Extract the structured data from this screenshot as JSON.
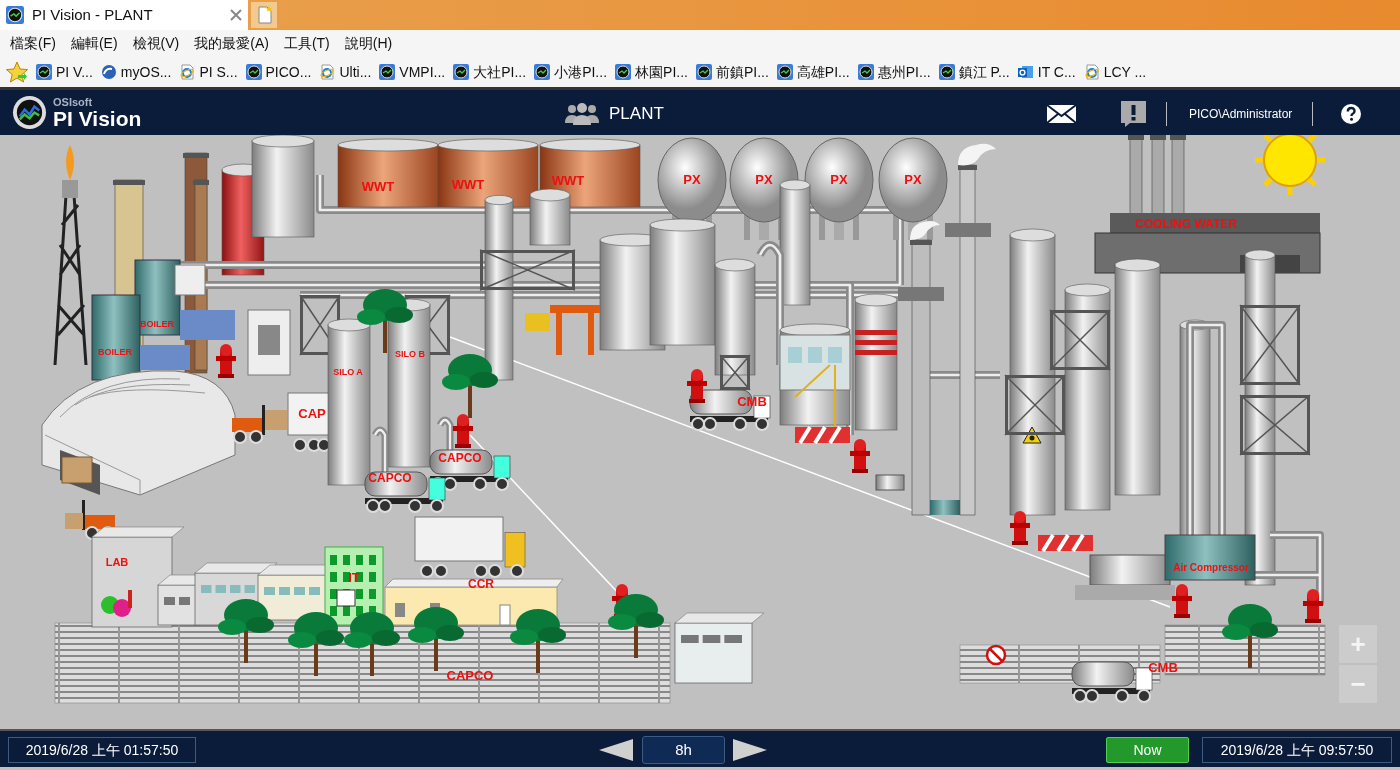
{
  "browser": {
    "tabs": [
      {
        "title": "PI Vision - PLANT",
        "selected": true
      }
    ],
    "menu": [
      "檔案(F)",
      "編輯(E)",
      "檢視(V)",
      "我的最愛(A)",
      "工具(T)",
      "說明(H)"
    ],
    "favorites": [
      {
        "label": "PI V...",
        "kind": "pi"
      },
      {
        "label": "myOS...",
        "kind": "swirl"
      },
      {
        "label": "PI S...",
        "kind": "page"
      },
      {
        "label": "PICO...",
        "kind": "pi"
      },
      {
        "label": "Ulti...",
        "kind": "page"
      },
      {
        "label": "VMPI...",
        "kind": "pi"
      },
      {
        "label": "大社PI...",
        "kind": "pi"
      },
      {
        "label": "小港PI...",
        "kind": "pi"
      },
      {
        "label": "林園PI...",
        "kind": "pi"
      },
      {
        "label": "前鎮PI...",
        "kind": "pi"
      },
      {
        "label": "高雄PI...",
        "kind": "pi"
      },
      {
        "label": "惠州PI...",
        "kind": "pi"
      },
      {
        "label": "鎮江 P...",
        "kind": "pi"
      },
      {
        "label": "IT C...",
        "kind": "tile"
      },
      {
        "label": "LCY ...",
        "kind": "page"
      }
    ]
  },
  "app": {
    "vendor": "OSIsoft",
    "product": "PI Vision",
    "display": "PLANT",
    "user": "PICO\\Administrator"
  },
  "plant": {
    "labels": [
      "WWT",
      "WWT",
      "WWT",
      "PX",
      "PX",
      "PX",
      "PX",
      "COOLING WATER",
      "BOILER",
      "BOILER",
      "SILO A",
      "SILO B",
      "CAP",
      "CAPCO",
      "CAPCO",
      "CAPCO",
      "CMB",
      "CMB",
      "LAB",
      "IT",
      "CCR",
      "Air Compressor"
    ],
    "zoom": [
      "+",
      "−"
    ]
  },
  "timebar": {
    "start": "2019/6/28 上午 01:57:50",
    "duration": "8h",
    "now": "Now",
    "end": "2019/6/28 上午 09:57:50"
  }
}
